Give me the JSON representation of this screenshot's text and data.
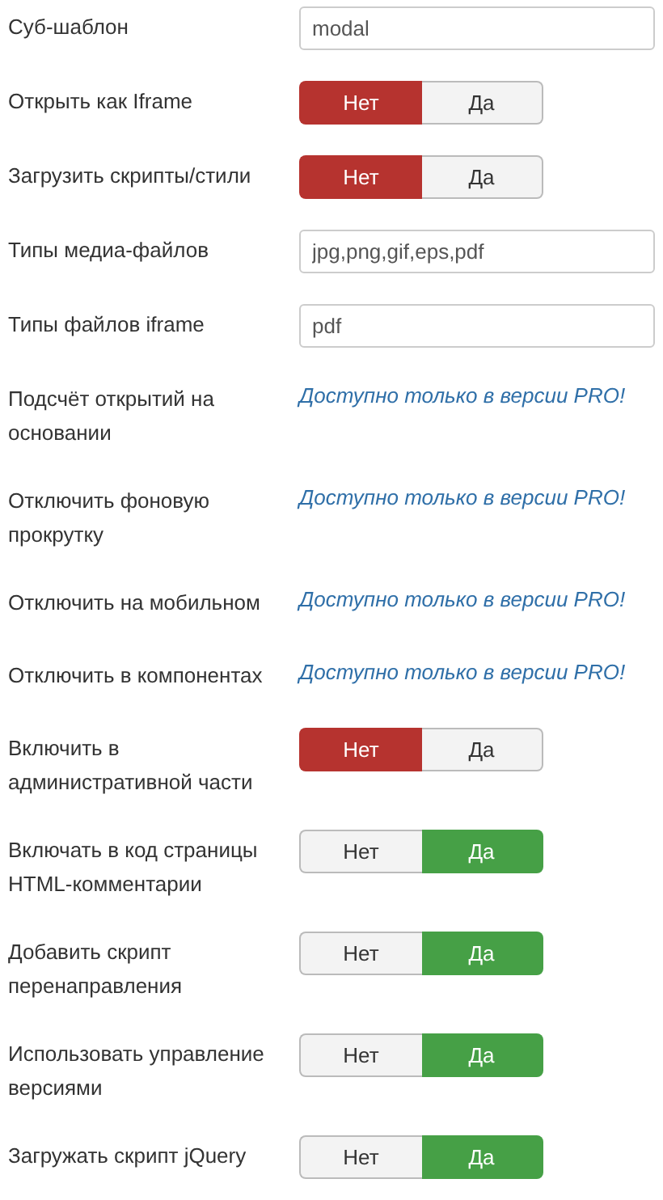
{
  "rows": [
    {
      "kind": "text",
      "label": "Суб-шаблон",
      "value": "modal"
    },
    {
      "kind": "toggle",
      "label": "Открыть как Iframe",
      "options": [
        {
          "label": "Нет",
          "selected": true
        },
        {
          "label": "Да",
          "selected": false
        }
      ]
    },
    {
      "kind": "toggle",
      "label": "Загрузить скрипты/стили",
      "options": [
        {
          "label": "Нет",
          "selected": true
        },
        {
          "label": "Да",
          "selected": false
        }
      ]
    },
    {
      "kind": "text",
      "label": "Типы медиа-файлов",
      "value": "jpg,png,gif,eps,pdf"
    },
    {
      "kind": "text",
      "label": "Типы файлов iframe",
      "value": "pdf"
    },
    {
      "kind": "pro",
      "label": "Подсчёт открытий на основании",
      "note": "Доступно только в версии PRO!"
    },
    {
      "kind": "pro",
      "label": "Отключить фоновую прокрутку",
      "note": "Доступно только в версии PRO!"
    },
    {
      "kind": "pro",
      "label": "Отключить на мобильном",
      "note": "Доступно только в версии PRO!"
    },
    {
      "kind": "pro",
      "label": "Отключить в компонентах",
      "note": "Доступно только в версии PRO!"
    },
    {
      "kind": "toggle",
      "label": "Включить в административной части",
      "options": [
        {
          "label": "Нет",
          "selected": true
        },
        {
          "label": "Да",
          "selected": false
        }
      ]
    },
    {
      "kind": "toggle",
      "label": "Включать в код страницы HTML-комментарии",
      "options": [
        {
          "label": "Нет",
          "selected": false
        },
        {
          "label": "Да",
          "selected": true
        }
      ]
    },
    {
      "kind": "toggle",
      "label": "Добавить скрипт перенаправления",
      "options": [
        {
          "label": "Нет",
          "selected": false
        },
        {
          "label": "Да",
          "selected": true
        }
      ]
    },
    {
      "kind": "toggle",
      "label": "Использовать управление версиями",
      "options": [
        {
          "label": "Нет",
          "selected": false
        },
        {
          "label": "Да",
          "selected": true
        }
      ]
    },
    {
      "kind": "toggle",
      "label": "Загружать скрипт jQuery",
      "options": [
        {
          "label": "Нет",
          "selected": false
        },
        {
          "label": "Да",
          "selected": true
        }
      ]
    }
  ]
}
